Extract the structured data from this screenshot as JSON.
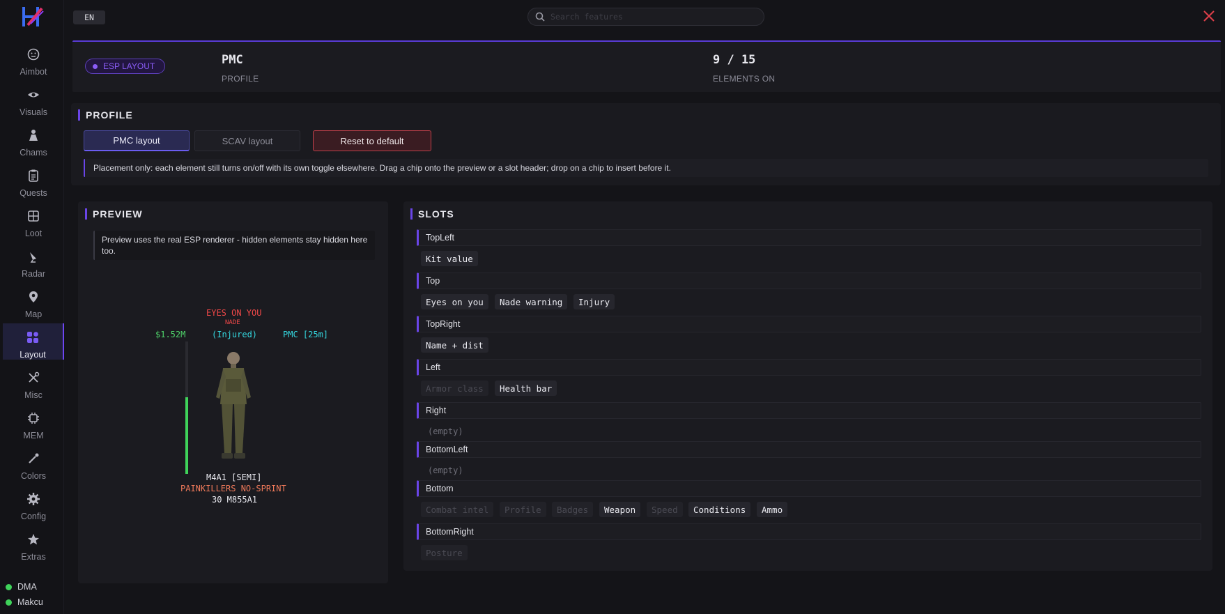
{
  "sidebar": {
    "items": [
      {
        "label": "Aimbot",
        "icon": "smiley-icon"
      },
      {
        "label": "Visuals",
        "icon": "eye-icon"
      },
      {
        "label": "Chams",
        "icon": "person-icon"
      },
      {
        "label": "Quests",
        "icon": "clipboard-icon"
      },
      {
        "label": "Loot",
        "icon": "grid-box-icon"
      },
      {
        "label": "Radar",
        "icon": "satellite-icon"
      },
      {
        "label": "Map",
        "icon": "map-pin-icon"
      },
      {
        "label": "Layout",
        "icon": "layout-icon",
        "active": true
      },
      {
        "label": "Misc",
        "icon": "tools-icon"
      },
      {
        "label": "MEM",
        "icon": "chip-icon"
      },
      {
        "label": "Colors",
        "icon": "eyedropper-icon"
      },
      {
        "label": "Config",
        "icon": "gear-icon"
      },
      {
        "label": "Extras",
        "icon": "star-icon"
      }
    ],
    "status": [
      {
        "label": "DMA",
        "color": "#3fd35a"
      },
      {
        "label": "Makcu",
        "color": "#3fd35a"
      }
    ]
  },
  "topbar": {
    "lang": "EN",
    "search_placeholder": "Search features"
  },
  "header": {
    "badge": "ESP LAYOUT",
    "profile_value": "PMC",
    "profile_label": "PROFILE",
    "elements_value": "9 / 15",
    "elements_label": "ELEMENTS ON"
  },
  "profile": {
    "title": "PROFILE",
    "buttons": [
      "PMC layout",
      "SCAV layout"
    ],
    "reset_label": "Reset to default",
    "note": "Placement only: each element still turns on/off with its own toggle elsewhere. Drag a chip onto the preview or a slot header; drop on a chip to insert before it."
  },
  "preview": {
    "title": "PREVIEW",
    "note": "Preview uses the real ESP renderer - hidden elements stay hidden here too.",
    "esp": {
      "eyes_on_you": "EYES ON YOU",
      "nade": "NADE",
      "kit_value": "$1.52M",
      "injury": "(Injured)",
      "name_dist": "PMC [25m]",
      "weapon": "M4A1 [SEMI]",
      "conditions": "PAINKILLERS NO-SPRINT",
      "ammo": "30 M855A1",
      "health_fraction": 0.58
    }
  },
  "slots": {
    "title": "SLOTS",
    "empty_label": "(empty)",
    "groups": [
      {
        "name": "TopLeft",
        "chips": [
          {
            "label": "Kit value",
            "on": true
          }
        ]
      },
      {
        "name": "Top",
        "chips": [
          {
            "label": "Eyes on you",
            "on": true
          },
          {
            "label": "Nade warning",
            "on": true
          },
          {
            "label": "Injury",
            "on": true
          }
        ]
      },
      {
        "name": "TopRight",
        "chips": [
          {
            "label": "Name + dist",
            "on": true
          }
        ]
      },
      {
        "name": "Left",
        "chips": [
          {
            "label": "Armor class",
            "on": false
          },
          {
            "label": "Health bar",
            "on": true
          }
        ]
      },
      {
        "name": "Right",
        "chips": []
      },
      {
        "name": "BottomLeft",
        "chips": []
      },
      {
        "name": "Bottom",
        "chips": [
          {
            "label": "Combat intel",
            "on": false
          },
          {
            "label": "Profile",
            "on": false
          },
          {
            "label": "Badges",
            "on": false
          },
          {
            "label": "Weapon",
            "on": true
          },
          {
            "label": "Speed",
            "on": false
          },
          {
            "label": "Conditions",
            "on": true
          },
          {
            "label": "Ammo",
            "on": true
          }
        ]
      },
      {
        "name": "BottomRight",
        "chips": [
          {
            "label": "Posture",
            "on": false
          }
        ]
      }
    ]
  },
  "colors": {
    "accent": "#6a45e8",
    "esp_red": "#f04848",
    "esp_green": "#4fd36a",
    "esp_cyan": "#34d8e0",
    "esp_orange": "#f07a5a",
    "danger": "#c0404a"
  }
}
